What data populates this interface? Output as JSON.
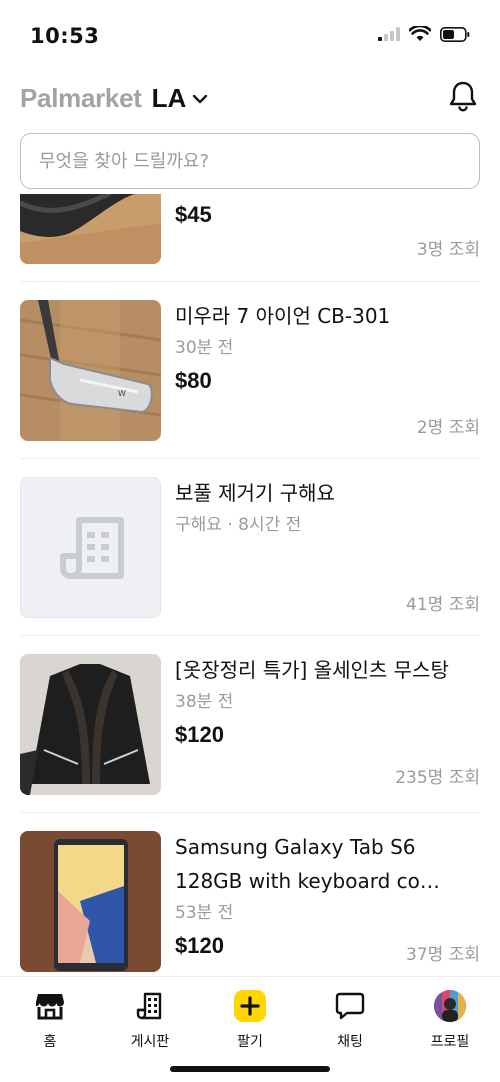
{
  "status_bar": {
    "time": "10:53"
  },
  "header": {
    "brand": "Palmarket",
    "location": "LA"
  },
  "search": {
    "placeholder": "무엇을 찾아 드릴까요?"
  },
  "listings": [
    {
      "title": "",
      "meta": "",
      "price": "$45",
      "views": "3명 조회",
      "thumb": "helmet"
    },
    {
      "title": "미우라 7 아이언 CB-301",
      "meta": "30분 전",
      "price": "$80",
      "views": "2명 조회",
      "thumb": "golf-iron"
    },
    {
      "title": "보풀 제거기 구해요",
      "meta": "구해요 · 8시간 전",
      "price": "",
      "views": "41명 조회",
      "thumb": "placeholder"
    },
    {
      "title": "[옷장정리 특가] 올세인츠 무스탕",
      "meta": "38분 전",
      "price": "$120",
      "views": "235명 조회",
      "thumb": "jacket"
    },
    {
      "title": "Samsung Galaxy Tab S6 128GB with keyboard co…",
      "meta": "53분 전",
      "price": "$120",
      "views": "37명 조회",
      "thumb": "tablet"
    }
  ],
  "bottom_nav": {
    "items": [
      {
        "label": "홈",
        "icon": "store-icon",
        "active": true
      },
      {
        "label": "게시판",
        "icon": "board-icon",
        "active": false
      },
      {
        "label": "팔기",
        "icon": "plus-icon",
        "active": false
      },
      {
        "label": "채팅",
        "icon": "chat-icon",
        "active": false
      },
      {
        "label": "프로필",
        "icon": "avatar",
        "active": false
      }
    ]
  },
  "colors": {
    "accent": "#FFD600",
    "brand_gray": "#A3A3A3",
    "muted_text": "#9B9B9B",
    "divider": "#EDEDED"
  }
}
